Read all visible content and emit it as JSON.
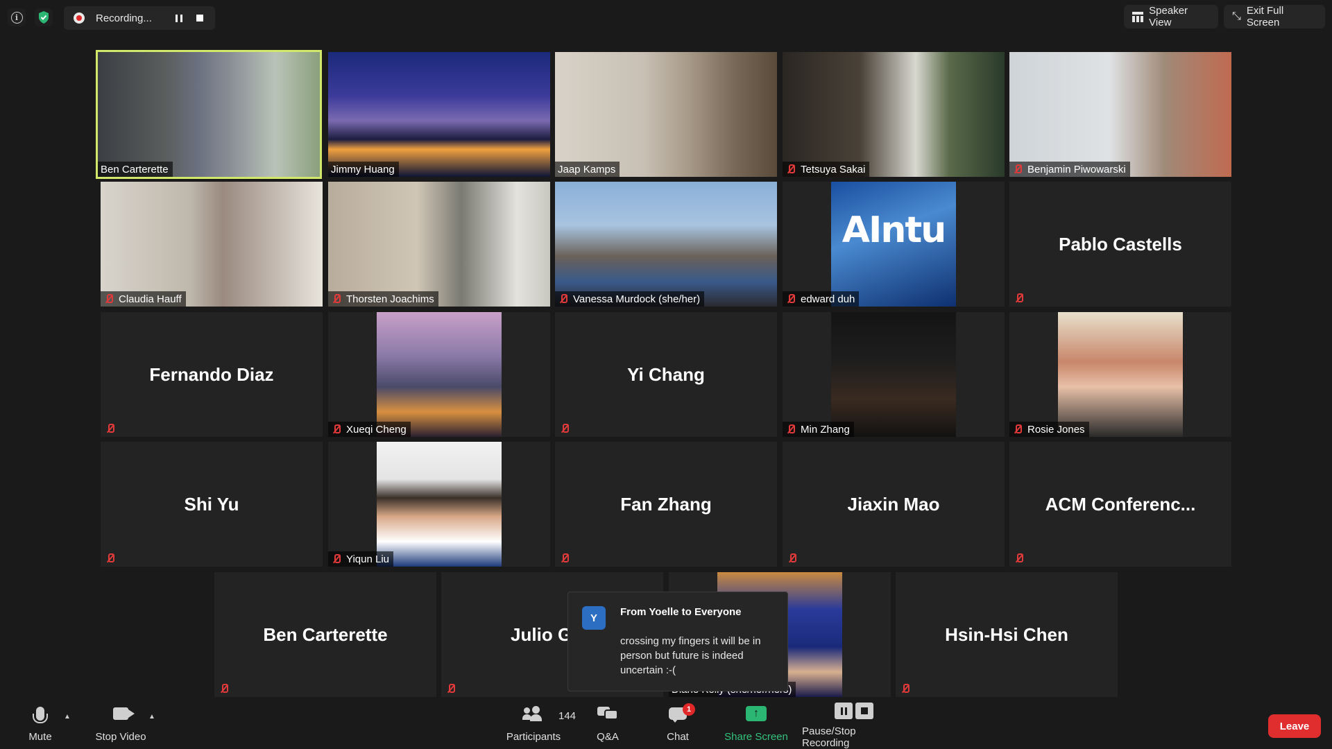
{
  "top_bar": {
    "info_icon": "info-icon",
    "security_icon": "shield-check-icon",
    "recording_label": "Recording...",
    "speaker_view_label": "Speaker View",
    "exit_full_screen_label": "Exit Full Screen"
  },
  "tiles": [
    {
      "name": "Ben Carterette",
      "kind": "video",
      "muted": false,
      "active": true
    },
    {
      "name": "Jimmy Huang",
      "kind": "video",
      "muted": false
    },
    {
      "name": "Jaap Kamps",
      "kind": "video",
      "muted": false
    },
    {
      "name": "Tetsuya Sakai",
      "kind": "video",
      "muted": true
    },
    {
      "name": "Benjamin Piwowarski",
      "kind": "video",
      "muted": true
    },
    {
      "name": "Claudia Hauff",
      "kind": "video",
      "muted": true
    },
    {
      "name": "Thorsten Joachims",
      "kind": "video",
      "muted": true
    },
    {
      "name": "Vanessa Murdock (she/her)",
      "kind": "video",
      "muted": true
    },
    {
      "name": "edward duh",
      "kind": "picture",
      "muted": true,
      "logo_text": "AIntu"
    },
    {
      "name": "Pablo Castells",
      "kind": "name",
      "muted": true
    },
    {
      "name": "Fernando Diaz",
      "kind": "name",
      "muted": true
    },
    {
      "name": "Xueqi Cheng",
      "kind": "picture",
      "muted": true
    },
    {
      "name": "Yi Chang",
      "kind": "name",
      "muted": true
    },
    {
      "name": "Min Zhang",
      "kind": "picture",
      "muted": true
    },
    {
      "name": "Rosie Jones",
      "kind": "picture",
      "muted": true
    },
    {
      "name": "Shi Yu",
      "kind": "name",
      "muted": true
    },
    {
      "name": "Yiqun Liu",
      "kind": "picture",
      "muted": true
    },
    {
      "name": "Fan Zhang",
      "kind": "name",
      "muted": true
    },
    {
      "name": "Jiaxin Mao",
      "kind": "name",
      "muted": true
    },
    {
      "name": "ACM  Conferenc...",
      "kind": "name",
      "muted": true
    },
    {
      "name": "Ben Carterette",
      "kind": "name",
      "muted": true
    },
    {
      "name": "Julio Gon",
      "kind": "name",
      "muted": true
    },
    {
      "name": "Diane Kelly (she/her/hers)",
      "kind": "picture",
      "muted": false
    },
    {
      "name": "Hsin-Hsi Chen",
      "kind": "name",
      "muted": true
    }
  ],
  "chat_toast": {
    "avatar_letter": "Y",
    "from": "From Yoelle to Everyone",
    "message": "crossing my fingers it will be in person but future is indeed uncertain :-("
  },
  "toolbar": {
    "mute_label": "Mute",
    "stop_video_label": "Stop Video",
    "participants_label": "Participants",
    "participants_count": "144",
    "qa_label": "Q&A",
    "chat_label": "Chat",
    "chat_badge": "1",
    "share_screen_label": "Share Screen",
    "pause_stop_recording_label": "Pause/Stop Recording",
    "leave_label": "Leave"
  },
  "colors": {
    "active_speaker_border": "#d2e86b",
    "muted_icon": "#e23a3a",
    "share_green": "#2bb673",
    "leave_red": "#e02d2d",
    "recording_red": "#e02828"
  }
}
